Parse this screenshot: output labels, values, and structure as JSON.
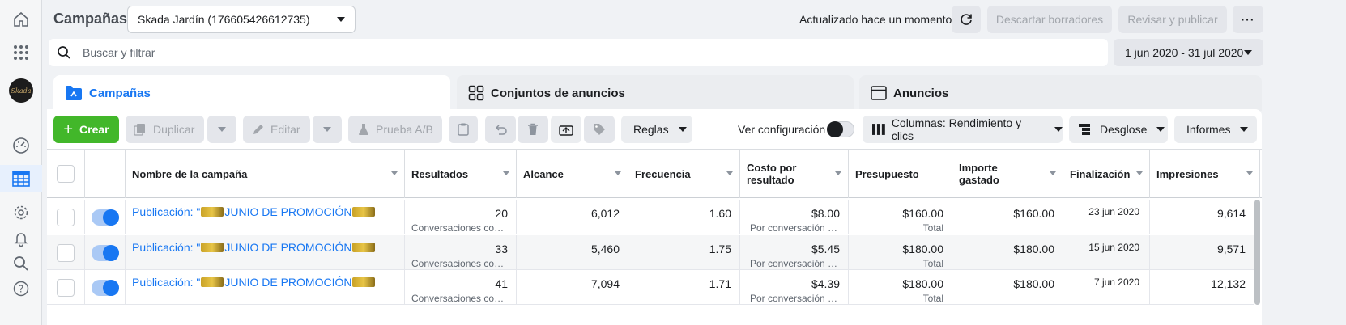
{
  "header": {
    "title": "Campañas",
    "account": "Skada Jardín (176605426612735)",
    "updated": "Actualizado hace un momento",
    "discard": "Descartar borradores",
    "review": "Revisar y publicar",
    "more": "···"
  },
  "search": {
    "placeholder": "Buscar y filtrar"
  },
  "date_range": "1 jun 2020 - 31 jul 2020",
  "tabs": [
    {
      "label": "Campañas"
    },
    {
      "label": "Conjuntos de anuncios"
    },
    {
      "label": "Anuncios"
    }
  ],
  "toolbar": {
    "create": "Crear",
    "duplicate": "Duplicar",
    "edit": "Editar",
    "ab_test": "Prueba A/B",
    "rules": "Reglas",
    "view_setup": "Ver configuración",
    "columns": "Columnas: Rendimiento y clics",
    "breakdown": "Desglose",
    "reports": "Informes"
  },
  "table": {
    "headers": [
      "Nombre de la campaña",
      "Resultados",
      "Alcance",
      "Frecuencia",
      "Costo por resultado",
      "Presupuesto",
      "Importe gastado",
      "Finalización",
      "Impresiones"
    ],
    "rows": [
      {
        "name_prefix": "Publicación: \"",
        "name_text": "JUNIO DE PROMOCIÓN",
        "results": "20",
        "results_sub": "Conversaciones con mensajes iniciadas",
        "reach": "6,012",
        "frequency": "1.60",
        "cost": "$8.00",
        "cost_sub": "Por conversación con mensajes iniciada",
        "budget": "$160.00",
        "budget_sub": "Total",
        "spent": "$160.00",
        "end": "23 jun 2020",
        "impressions": "9,614"
      },
      {
        "name_prefix": "Publicación: \"",
        "name_text": "JUNIO DE PROMOCIÓN",
        "results": "33",
        "results_sub": "Conversaciones con mensajes iniciadas",
        "reach": "5,460",
        "frequency": "1.75",
        "cost": "$5.45",
        "cost_sub": "Por conversación con mensajes iniciada",
        "budget": "$180.00",
        "budget_sub": "Total",
        "spent": "$180.00",
        "end": "15 jun 2020",
        "impressions": "9,571"
      },
      {
        "name_prefix": "Publicación: \"",
        "name_text": "JUNIO DE PROMOCIÓN",
        "results": "41",
        "results_sub": "Conversaciones con mensajes iniciadas",
        "reach": "7,094",
        "frequency": "1.71",
        "cost": "$4.39",
        "cost_sub": "Por conversación con mensajes iniciada",
        "budget": "$180.00",
        "budget_sub": "Total",
        "spent": "$180.00",
        "end": "7 jun 2020",
        "impressions": "12,132"
      }
    ]
  },
  "colors": {
    "accent": "#1877f2",
    "create": "#42b72a",
    "toggle_on": "#1877f2"
  }
}
